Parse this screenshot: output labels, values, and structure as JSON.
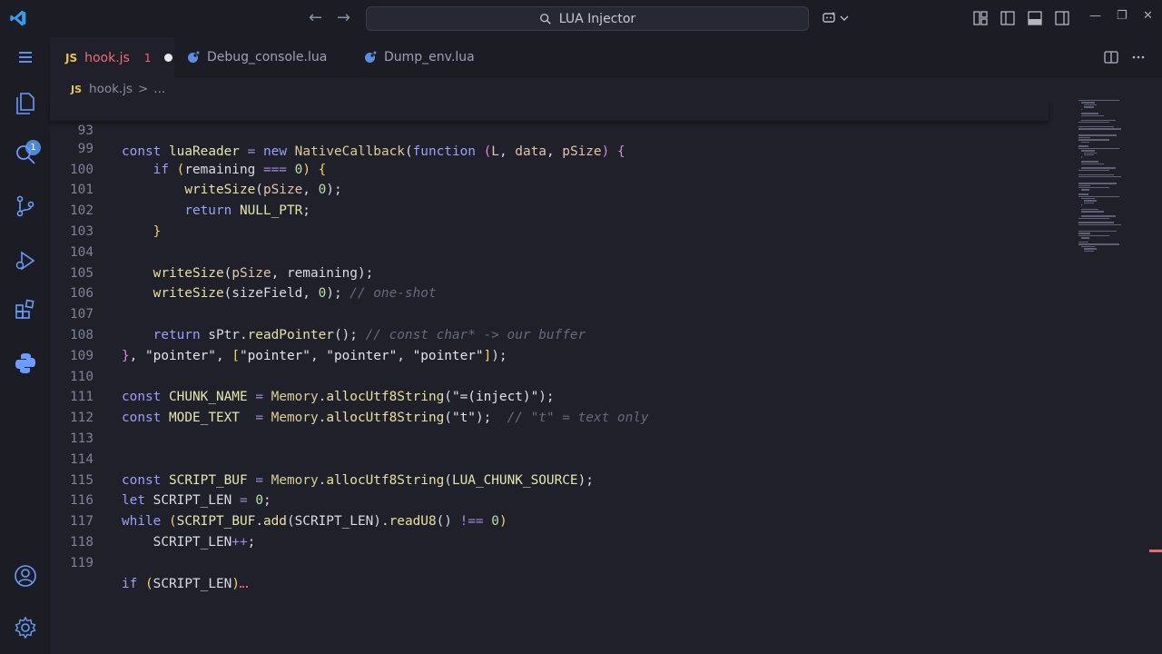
{
  "titlebar": {
    "search_text": "LUA Injector"
  },
  "activity": {
    "explorer_badge": "1"
  },
  "tabs": [
    {
      "label": "hook.js",
      "type_tag": "JS",
      "problem_count": "1",
      "modified": true,
      "active": true
    },
    {
      "label": "Debug_console.lua",
      "type_tag": "lua"
    },
    {
      "label": "Dump_env.lua",
      "type_tag": "lua"
    }
  ],
  "breadcrumb": {
    "type_tag": "JS",
    "file": "hook.js",
    "separator": ">",
    "rest": "..."
  },
  "editor": {
    "line_numbers": [
      "93",
      "99",
      "100",
      "101",
      "102",
      "103",
      "104",
      "105",
      "106",
      "107",
      "108",
      "109",
      "110",
      "111",
      "112",
      "113",
      "114",
      "115",
      "116",
      "117",
      "118",
      "119"
    ],
    "lines": [
      "const luaReader = new NativeCallback(function (L, data, pSize) {",
      "    if (remaining === 0) {",
      "        writeSize(pSize, 0);",
      "        return NULL_PTR;",
      "    }",
      "",
      "    writeSize(pSize, remaining);",
      "    writeSize(sizeField, 0); // one-shot",
      "",
      "    return sPtr.readPointer(); // const char* -> our buffer",
      "}, \"pointer\", [\"pointer\", \"pointer\", \"pointer\"]);",
      "",
      "const CHUNK_NAME = Memory.allocUtf8String(\"=(inject)\");",
      "const MODE_TEXT  = Memory.allocUtf8String(\"t\");  // \"t\" = text only",
      "",
      "",
      "const SCRIPT_BUF = Memory.allocUtf8String(LUA_CHUNK_SOURCE);",
      "let SCRIPT_LEN = 0;",
      "while (SCRIPT_BUF.add(SCRIPT_LEN).readU8() !== 0)",
      "    SCRIPT_LEN++;",
      "",
      "if (SCRIPT_LEN)"
    ]
  },
  "colors": {
    "background": "#1f2029",
    "accent": "#4d8ad6",
    "error": "#ef6b73",
    "keyword": "#9e9efc",
    "comment": "#666a7d"
  },
  "icons": [
    "vscode-logo-icon",
    "arrow-left-icon",
    "arrow-right-icon",
    "search-icon",
    "copilot-icon",
    "chevron-down-icon",
    "toggle-primary-sidebar-icon",
    "toggle-panel-icon",
    "toggle-secondary-sidebar-icon",
    "customize-layout-icon",
    "minimize-icon",
    "restore-icon",
    "close-icon",
    "menu-icon",
    "explorer-icon",
    "search-view-icon",
    "source-control-icon",
    "run-debug-icon",
    "extensions-icon",
    "python-icon",
    "account-icon",
    "settings-gear-icon",
    "split-editor-icon",
    "more-actions-icon",
    "lua-file-icon"
  ]
}
